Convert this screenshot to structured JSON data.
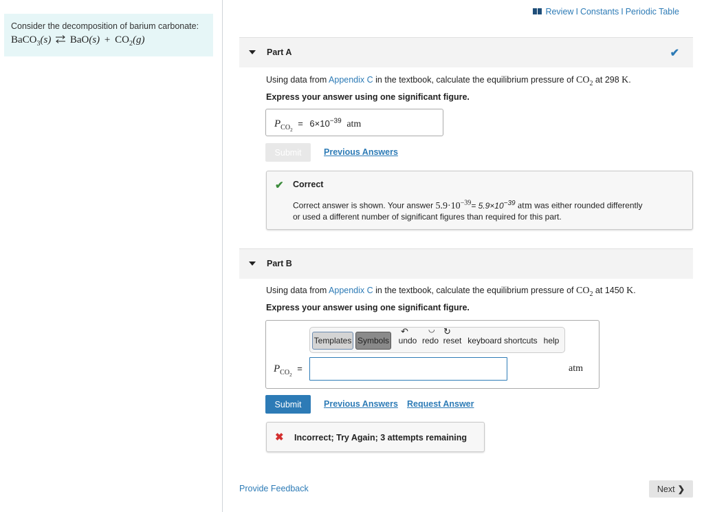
{
  "intro": {
    "text": "Consider the decomposition of barium carbonate:",
    "reactant": "BaCO",
    "reactant_sub": "3",
    "reactant_state": "(s)",
    "product1": "BaO",
    "product1_state": "(s)",
    "plus": "+",
    "product2": "CO",
    "product2_sub": "2",
    "product2_state": "(g)"
  },
  "top_links": {
    "review": "Review",
    "sep": "I",
    "constants": "Constants",
    "periodic": "Periodic Table"
  },
  "part_a": {
    "title": "Part A",
    "question_pre": "Using data from",
    "appendix_link": "Appendix C",
    "question_mid": "in the textbook, calculate the equilibrium pressure of",
    "species": "CO",
    "species_sub": "2",
    "question_at": "at 298",
    "unit_k": "K",
    "instruction": "Express your answer using one significant figure.",
    "var": "P",
    "var_sub": "CO",
    "var_sub2": "2",
    "equals": "=",
    "answer_mantissa": "6×10",
    "answer_exp": "−39",
    "answer_unit": "atm",
    "submit_label": "Submit",
    "previous_answers": "Previous Answers",
    "feedback_title": "Correct",
    "feedback_pre": "Correct answer is shown. Your answer",
    "feedback_val": "5.9·10",
    "feedback_exp": "−39",
    "feedback_eq": "= 5.9×10",
    "feedback_eq_exp": "−39",
    "feedback_unit": "atm",
    "feedback_post": "was either rounded differently",
    "feedback_line2": "or used a different number of significant figures than required for this part."
  },
  "part_b": {
    "title": "Part B",
    "question_pre": "Using data from",
    "appendix_link": "Appendix C",
    "question_mid": "in the textbook, calculate the equilibrium pressure of",
    "species": "CO",
    "species_sub": "2",
    "question_at": "at 1450",
    "unit_k": "K",
    "instruction": "Express your answer using one significant figure.",
    "toolbar": {
      "templates": "Templates",
      "symbols": "Symbols",
      "undo": "undo",
      "redo": "redo",
      "reset": "reset",
      "shortcuts": "keyboard shortcuts",
      "help": "help"
    },
    "var": "P",
    "var_sub": "CO",
    "var_sub2": "2",
    "equals": "=",
    "input_value": "",
    "answer_unit": "atm",
    "submit_label": "Submit",
    "previous_answers": "Previous Answers",
    "request_answer": "Request Answer",
    "feedback_text": "Incorrect; Try Again; 3 attempts remaining"
  },
  "footer": {
    "provide_feedback": "Provide Feedback",
    "next": "Next"
  },
  "colors": {
    "accent": "#2d7bb6",
    "correct": "#3c8c3c",
    "incorrect": "#d32f2f",
    "intro_bg": "#e6f6f7"
  }
}
